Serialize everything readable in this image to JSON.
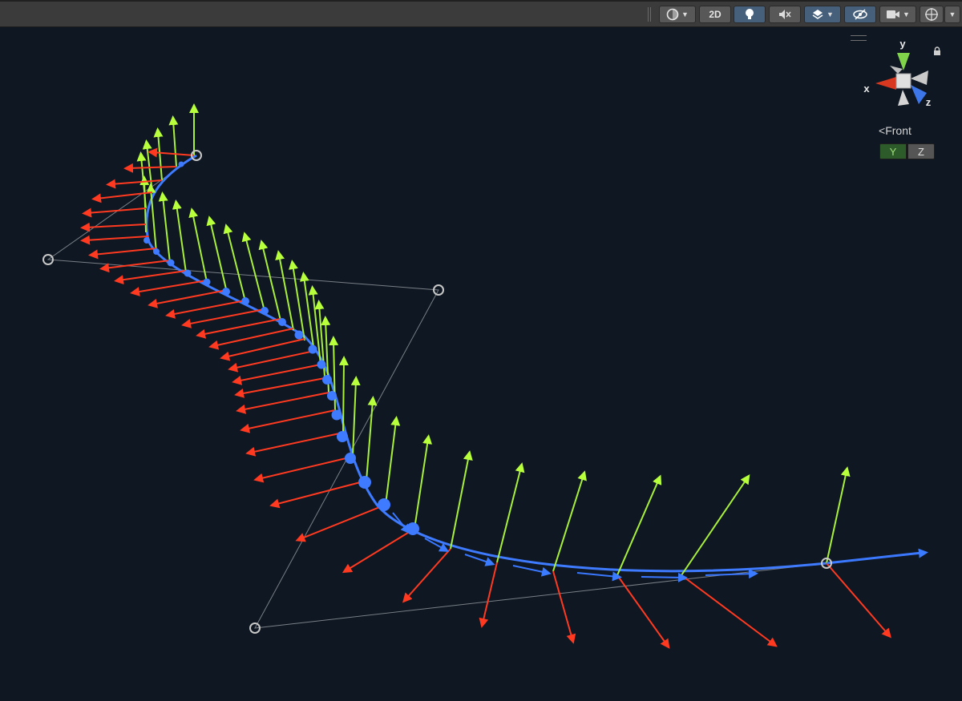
{
  "toolbar": {
    "shading_mode_icon": "shading-sphere-icon",
    "btn_2d": "2D",
    "lighting_icon": "lightbulb-icon",
    "audio_icon": "audio-mute-icon",
    "effects_icon": "effects-layers-icon",
    "visibility_icon": "scene-visibility-icon",
    "camera_icon": "camera-icon",
    "gizmos_icon": "gizmos-icon"
  },
  "orientation_gizmo": {
    "y_label": "y",
    "x_label": "x",
    "z_label": "z",
    "view_name": "Front",
    "axis_y": "Y",
    "axis_z": "Z"
  },
  "colors": {
    "background": "#0e1722",
    "curve": "#3f7bff",
    "up_vector": "#a9f03c",
    "right_vector": "#ff3a20",
    "forward_vector": "#3a78ff",
    "control_point": "#c8c8c8",
    "handle_line": "#7a7f86"
  }
}
